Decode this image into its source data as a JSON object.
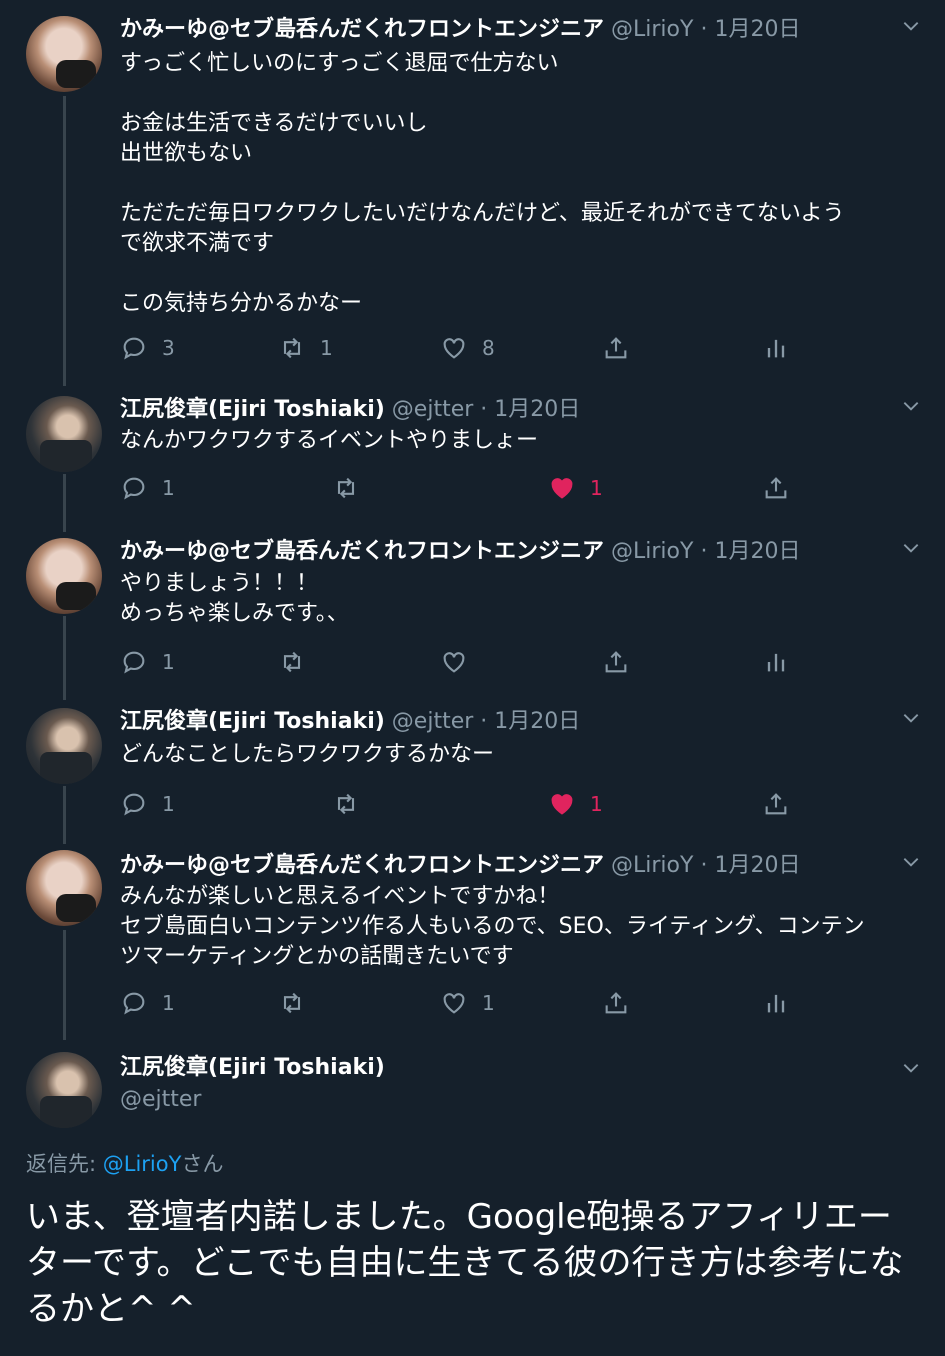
{
  "tweets": [
    {
      "name": "かみーゆ@セブ島呑んだくれフロントエンジニア",
      "handle": "@LirioY",
      "dot": "·",
      "date": "1月20日",
      "text": "すっごく忙しいのにすっごく退屈で仕方ない\n\nお金は生活できるだけでいいし\n出世欲もない\n\nただただ毎日ワクワクしたいだけなんだけど、最近それができてないよう\nで欲求不満です\n\nこの気持ち分かるかなー",
      "reply_count": "3",
      "retweet_count": "1",
      "like_count": "8"
    },
    {
      "name": "江尻俊章(Ejiri Toshiaki)",
      "handle": "@ejtter",
      "dot": "·",
      "date": "1月20日",
      "text": "なんかワクワクするイベントやりましょー",
      "reply_count": "1",
      "retweet_count": "",
      "like_count": "1"
    },
    {
      "name": "かみーゆ@セブ島呑んだくれフロントエンジニア",
      "handle": "@LirioY",
      "dot": "·",
      "date": "1月20日",
      "text": "やりましょう！！！\nめっちゃ楽しみです。、",
      "reply_count": "1",
      "retweet_count": "",
      "like_count": ""
    },
    {
      "name": "江尻俊章(Ejiri Toshiaki)",
      "handle": "@ejtter",
      "dot": "·",
      "date": "1月20日",
      "text": "どんなことしたらワクワクするかなー",
      "reply_count": "1",
      "retweet_count": "",
      "like_count": "1"
    },
    {
      "name": "かみーゆ@セブ島呑んだくれフロントエンジニア",
      "handle": "@LirioY",
      "dot": "·",
      "date": "1月20日",
      "text": "みんなが楽しいと思えるイベントですかね！\nセブ島面白いコンテンツ作る人もいるので、SEO、ライティング、コンテン\nツマーケティングとかの話聞きたいです",
      "reply_count": "1",
      "retweet_count": "",
      "like_count": "1"
    }
  ],
  "main": {
    "name": "江尻俊章(Ejiri Toshiaki)",
    "handle": "@ejtter",
    "replying_prefix": "返信先: ",
    "replying_mention": "@LirioY",
    "replying_suffix": "さん",
    "text": "いま、登壇者内諾しました。Google砲操るアフィリエーターです。どこでも自由に生きてる彼の行き方は参考になるかと^ ^"
  },
  "colors": {
    "background": "#15202b",
    "secondary_text": "#8899a6",
    "link": "#1da1f2",
    "like": "#e0245e",
    "thread_line": "#38444d"
  },
  "icons": [
    "reply-icon",
    "retweet-icon",
    "like-icon",
    "share-icon",
    "analytics-icon",
    "chevron-down-icon"
  ]
}
